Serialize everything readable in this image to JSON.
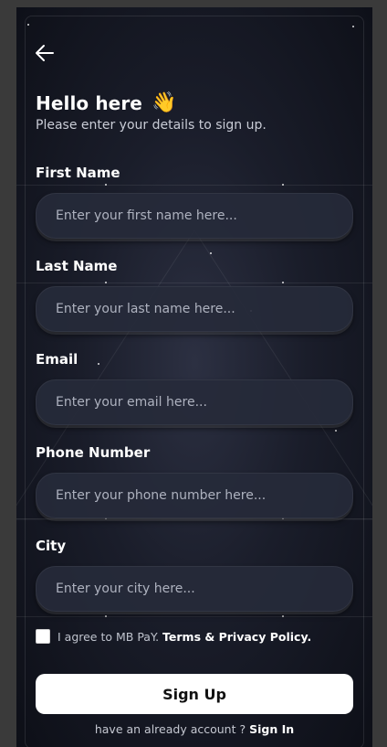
{
  "header": {
    "back_icon": "arrow-left-icon",
    "title": "Hello here",
    "title_emoji": "👋",
    "subtitle": "Please enter your details to sign up."
  },
  "form": {
    "first_name": {
      "label": "First Name",
      "placeholder": "Enter your first name here..."
    },
    "last_name": {
      "label": "Last Name",
      "placeholder": "Enter your last name here..."
    },
    "email": {
      "label": "Email",
      "placeholder": "Enter your email here..."
    },
    "phone": {
      "label": "Phone Number",
      "placeholder": "Enter your phone number here..."
    },
    "city": {
      "label": "City",
      "placeholder": "Enter your city here..."
    }
  },
  "agreement": {
    "checked": false,
    "prefix": "I agree to MB PaY.",
    "link": "Terms & Privacy Policy."
  },
  "submit": {
    "label": "Sign Up"
  },
  "footer": {
    "prompt": "have an already account ?",
    "link": "Sign In"
  },
  "colors": {
    "background": "#0d0f17",
    "field_bg": "#262a3a",
    "button_bg": "#ffffff",
    "text": "#ffffff",
    "muted_text": "#aeb2bf"
  }
}
